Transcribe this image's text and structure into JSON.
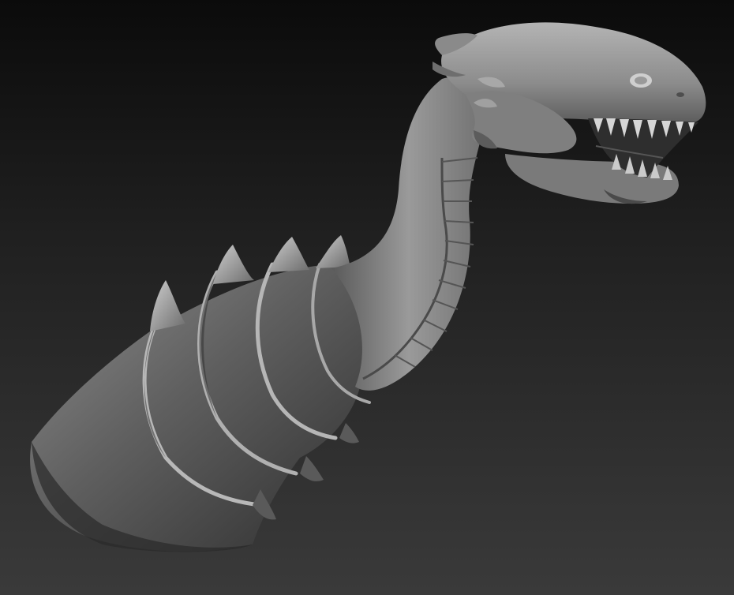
{
  "scene": {
    "subject": "sculpted-serpent-creature",
    "background_top": "#0b0b0b",
    "background_bottom": "#3a3a3a",
    "clay_light": "#9a9a9a",
    "clay_mid": "#6e6e6e",
    "clay_dark": "#3c3c3c"
  }
}
